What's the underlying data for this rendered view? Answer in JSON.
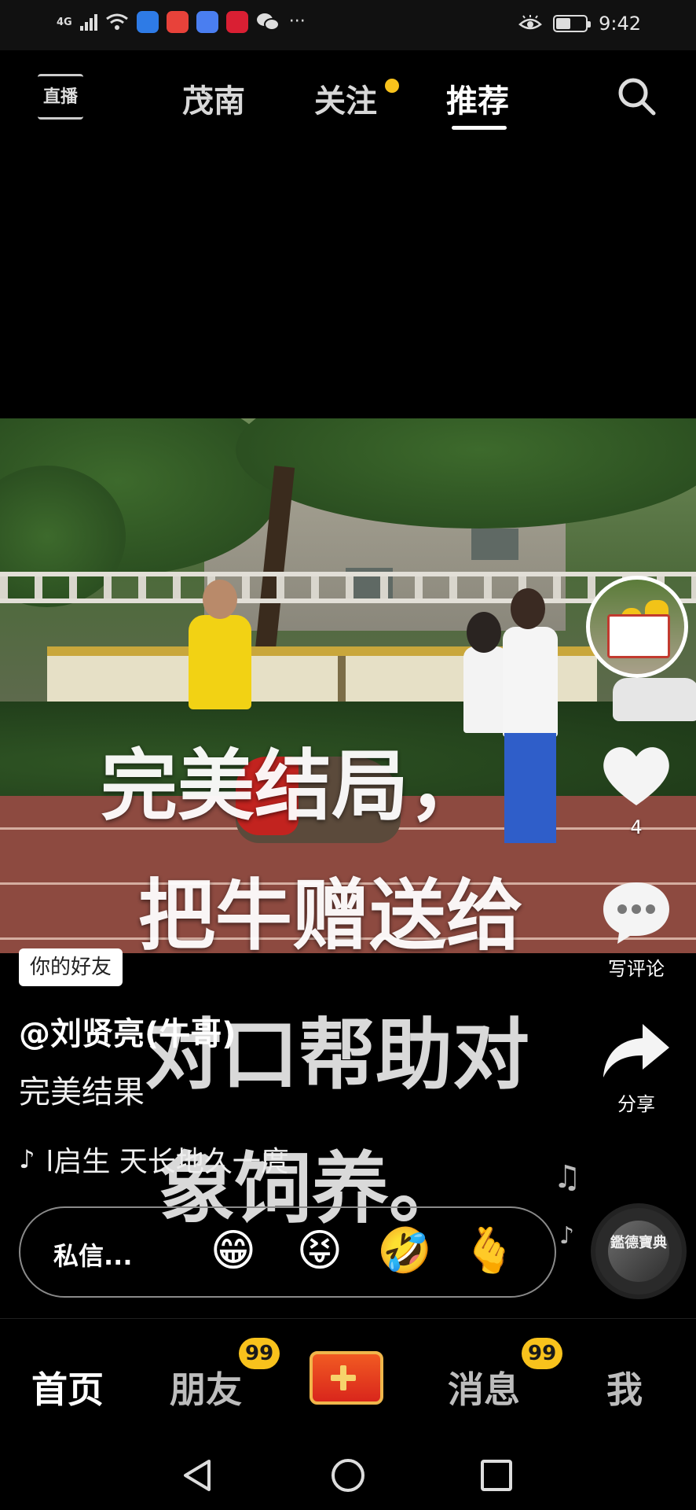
{
  "status_bar": {
    "network": "4G",
    "time": "9:42",
    "battery_level": 0.5,
    "more_label": "···"
  },
  "top_nav": {
    "live_label": "直播",
    "tabs": [
      {
        "label": "茂南",
        "active": false
      },
      {
        "label": "关注",
        "active": false,
        "has_dot": true
      },
      {
        "label": "推荐",
        "active": true
      }
    ]
  },
  "video": {
    "caption_lines": [
      "完美结局，",
      "把牛赠送给",
      "对口帮助对",
      "象饲养。"
    ]
  },
  "actions": {
    "like_count": "4",
    "comment_label": "写评论",
    "share_label": "分享"
  },
  "post": {
    "friend_tag": "你的好友",
    "author": "@刘贤亮(牛哥)",
    "description": "完美结果",
    "music": "l启生   天长地久一庹"
  },
  "chat_bar": {
    "label": "私信...",
    "emojis": [
      "😁",
      "😝",
      "🤣",
      "🫰"
    ]
  },
  "disc": {
    "text": "鑑德寶典"
  },
  "bottom_nav": {
    "items": [
      {
        "label": "首页",
        "active": true
      },
      {
        "label": "朋友",
        "badge": "99"
      },
      {
        "label": "消息",
        "badge": "99"
      },
      {
        "label": "我"
      }
    ]
  },
  "colors": {
    "badge": "#f8c21c",
    "create_button": "#e63a1e"
  }
}
